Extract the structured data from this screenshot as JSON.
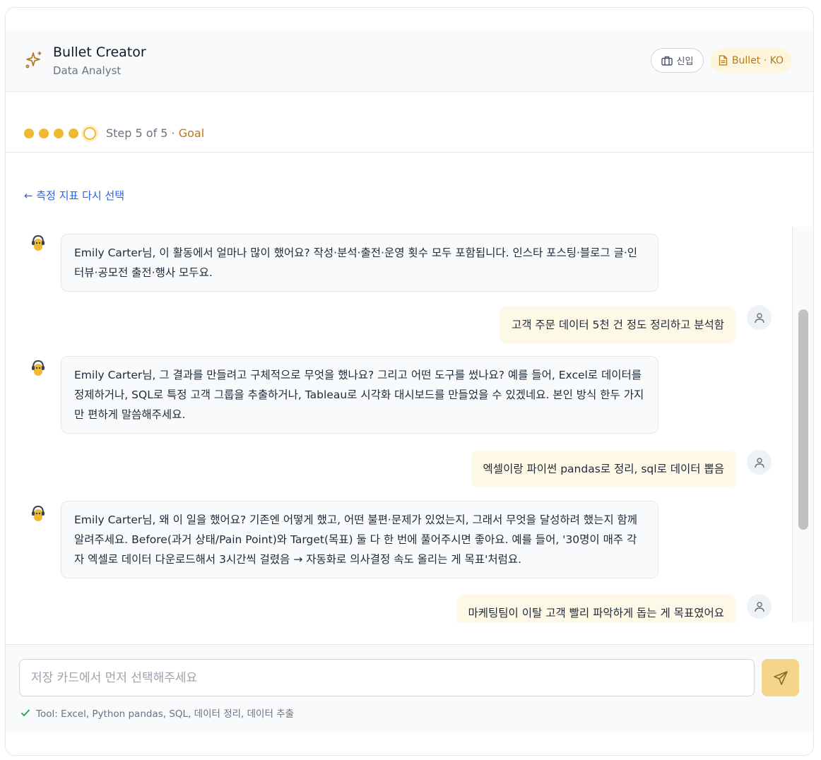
{
  "header": {
    "title": "Bullet Creator",
    "subtitle": "Data Analyst",
    "level_label": "신입",
    "bullet_label": "Bullet · KO",
    "accent": "#f0b932"
  },
  "stepper": {
    "step_text": "Step 5 of 5 · ",
    "goal_label": "Goal",
    "total_steps": 5,
    "current_step": 5
  },
  "back_link": "← 측정 지표 다시 선택",
  "messages": [
    {
      "role": "bot",
      "text": "Emily Carter님, 이 활동에서 얼마나 많이 했어요? 작성·분석·출전·운영 횟수 모두 포함됩니다. 인스타 포스팅·블로그 글·인터뷰·공모전 출전·행사 모두요."
    },
    {
      "role": "user",
      "text": "고객 주문 데이터 5천 건 정도 정리하고 분석함"
    },
    {
      "role": "bot",
      "text": "Emily Carter님, 그 결과를 만들려고 구체적으로 무엇을 했나요? 그리고 어떤 도구를 썼나요? 예를 들어, Excel로 데이터를 정제하거나, SQL로 특정 고객 그룹을 추출하거나, Tableau로 시각화 대시보드를 만들었을 수 있겠네요. 본인 방식 한두 가지만 편하게 말씀해주세요."
    },
    {
      "role": "user",
      "text": "엑셀이랑 파이썬 pandas로 정리, sql로 데이터 뽑음"
    },
    {
      "role": "bot",
      "text": "Emily Carter님, 왜 이 일을 했어요? 기존엔 어떻게 했고, 어떤 불편·문제가 있었는지, 그래서 무엇을 달성하려 했는지 함께 알려주세요. Before(과거 상태/Pain Point)와 Target(목표) 둘 다 한 번에 풀어주시면 좋아요. 예를 들어, '30명이 매주 각자 엑셀로 데이터 다운로드해서 3시간씩 걸렸음 → 자동화로 의사결정 속도 올리는 게 목표'처럼요."
    },
    {
      "role": "user",
      "text": "마케팅팀이 이탈 고객 빨리 파악하게 돕는 게 목표였어요"
    }
  ],
  "composer": {
    "placeholder": "저장 카드에서 먼저 선택해주세요",
    "value": ""
  },
  "tool_line": "Tool: Excel, Python pandas, SQL, 데이터 정리, 데이터 추출"
}
